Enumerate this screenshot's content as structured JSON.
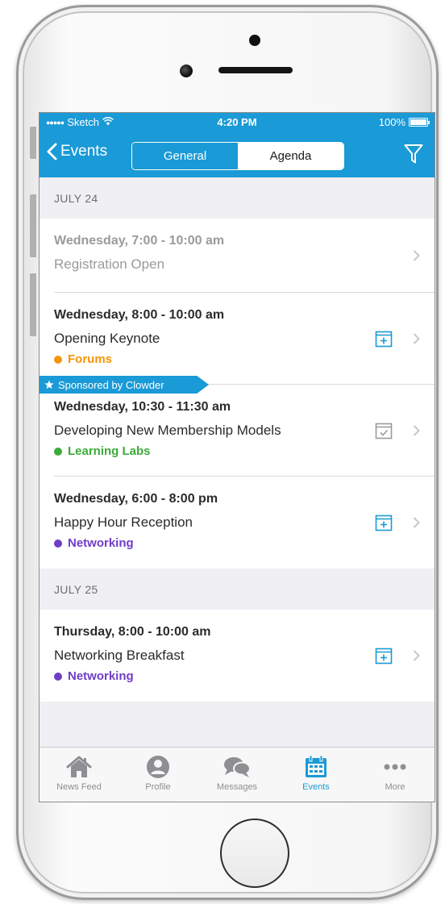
{
  "status_bar": {
    "carrier": "Sketch",
    "time": "4:20 PM",
    "battery": "100%",
    "battery_level": 1.0
  },
  "nav": {
    "back_label": "Events",
    "segments": [
      "General",
      "Agenda"
    ],
    "selected_segment": "Agenda"
  },
  "sections": [
    {
      "date": "JULY 24",
      "events": [
        {
          "time": "Wednesday, 7:00 - 10:00 am",
          "title": "Registration Open",
          "tag": null,
          "sponsor": null,
          "calendar_state": "none",
          "muted": true
        },
        {
          "time": "Wednesday, 8:00 - 10:00 am",
          "title": "Opening Keynote",
          "tag": {
            "label": "Forums",
            "color": "#f5960a"
          },
          "sponsor": null,
          "calendar_state": "add",
          "muted": false
        },
        {
          "time": "Wednesday, 10:30 - 11:30 am",
          "title": "Developing New Membership Models",
          "tag": {
            "label": "Learning Labs",
            "color": "#3cab3a"
          },
          "sponsor": "Sponsored by Clowder",
          "calendar_state": "added",
          "muted": false
        },
        {
          "time": "Wednesday, 6:00 - 8:00 pm",
          "title": "Happy Hour Reception",
          "tag": {
            "label": "Networking",
            "color": "#6f3ec6"
          },
          "sponsor": null,
          "calendar_state": "add",
          "muted": false
        }
      ]
    },
    {
      "date": "JULY 25",
      "events": [
        {
          "time": "Thursday, 8:00 - 10:00 am",
          "title": "Networking Breakfast",
          "tag": {
            "label": "Networking",
            "color": "#6f3ec6"
          },
          "sponsor": null,
          "calendar_state": "add",
          "muted": false
        }
      ]
    }
  ],
  "tab_bar": {
    "items": [
      {
        "label": "News Feed",
        "icon": "home-icon",
        "active": false
      },
      {
        "label": "Profile",
        "icon": "profile-icon",
        "active": false
      },
      {
        "label": "Messages",
        "icon": "messages-icon",
        "active": false
      },
      {
        "label": "Events",
        "icon": "calendar-icon",
        "active": true
      },
      {
        "label": "More",
        "icon": "more-icon",
        "active": false
      }
    ]
  },
  "colors": {
    "accent": "#1a9ad6",
    "forums": "#f5960a",
    "learning_labs": "#3cab3a",
    "networking": "#6f3ec6",
    "inactive_icon": "#8e8e93"
  }
}
